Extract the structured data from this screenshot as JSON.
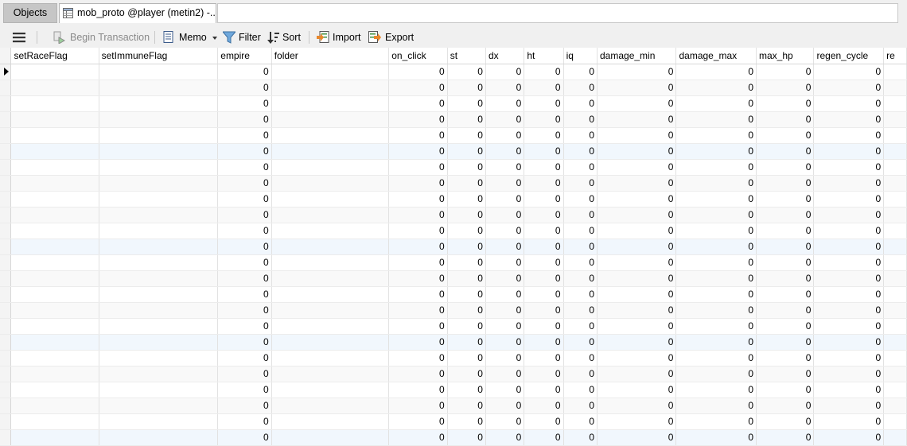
{
  "tabs": {
    "objects_label": "Objects",
    "table_tab_label": "mob_proto @player (metin2) -..."
  },
  "toolbar": {
    "begin_transaction": "Begin Transaction",
    "memo": "Memo",
    "filter": "Filter",
    "sort": "Sort",
    "import": "Import",
    "export": "Export"
  },
  "grid": {
    "columns": [
      "setRaceFlag",
      "setImmuneFlag",
      "empire",
      "folder",
      "on_click",
      "st",
      "dx",
      "ht",
      "iq",
      "damage_min",
      "damage_max",
      "max_hp",
      "regen_cycle",
      "re"
    ],
    "row_values": {
      "empire": "0",
      "on_click": "0",
      "st": "0",
      "dx": "0",
      "ht": "0",
      "iq": "0",
      "damage_min": "0",
      "damage_max": "0",
      "max_hp": "0",
      "regen_cycle": "0"
    },
    "row_count": 24,
    "highlight_rows": [
      5,
      11,
      17,
      23
    ]
  }
}
